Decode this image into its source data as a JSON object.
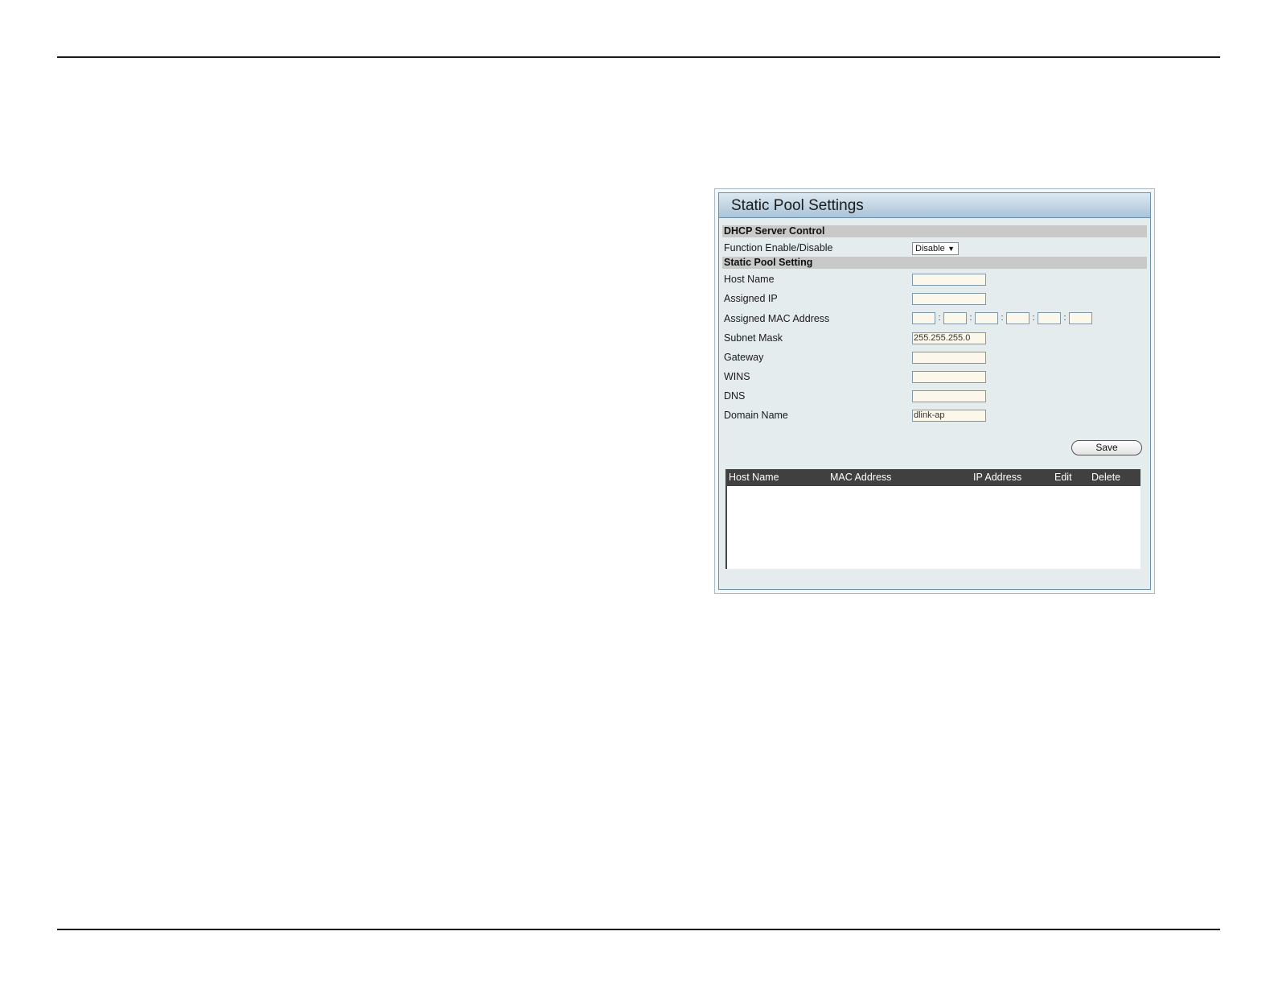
{
  "panel": {
    "title": "Static Pool Settings",
    "sections": {
      "dhcp_control": "DHCP Server Control",
      "static_pool": "Static Pool Setting"
    },
    "function_enable": {
      "label": "Function Enable/Disable",
      "selected": "Disable"
    },
    "fields": {
      "host_name": {
        "label": "Host Name",
        "value": ""
      },
      "assigned_ip": {
        "label": "Assigned IP",
        "value": ""
      },
      "assigned_mac": {
        "label": "Assigned MAC Address",
        "separator": ":"
      },
      "subnet_mask": {
        "label": "Subnet Mask",
        "value": "255.255.255.0"
      },
      "gateway": {
        "label": "Gateway",
        "value": ""
      },
      "wins": {
        "label": "WINS",
        "value": ""
      },
      "dns": {
        "label": "DNS",
        "value": ""
      },
      "domain_name": {
        "label": "Domain Name",
        "value": "dlink-ap"
      }
    },
    "save_label": "Save",
    "table": {
      "columns": [
        "Host Name",
        "MAC Address",
        "IP Address",
        "Edit",
        "Delete"
      ]
    }
  }
}
